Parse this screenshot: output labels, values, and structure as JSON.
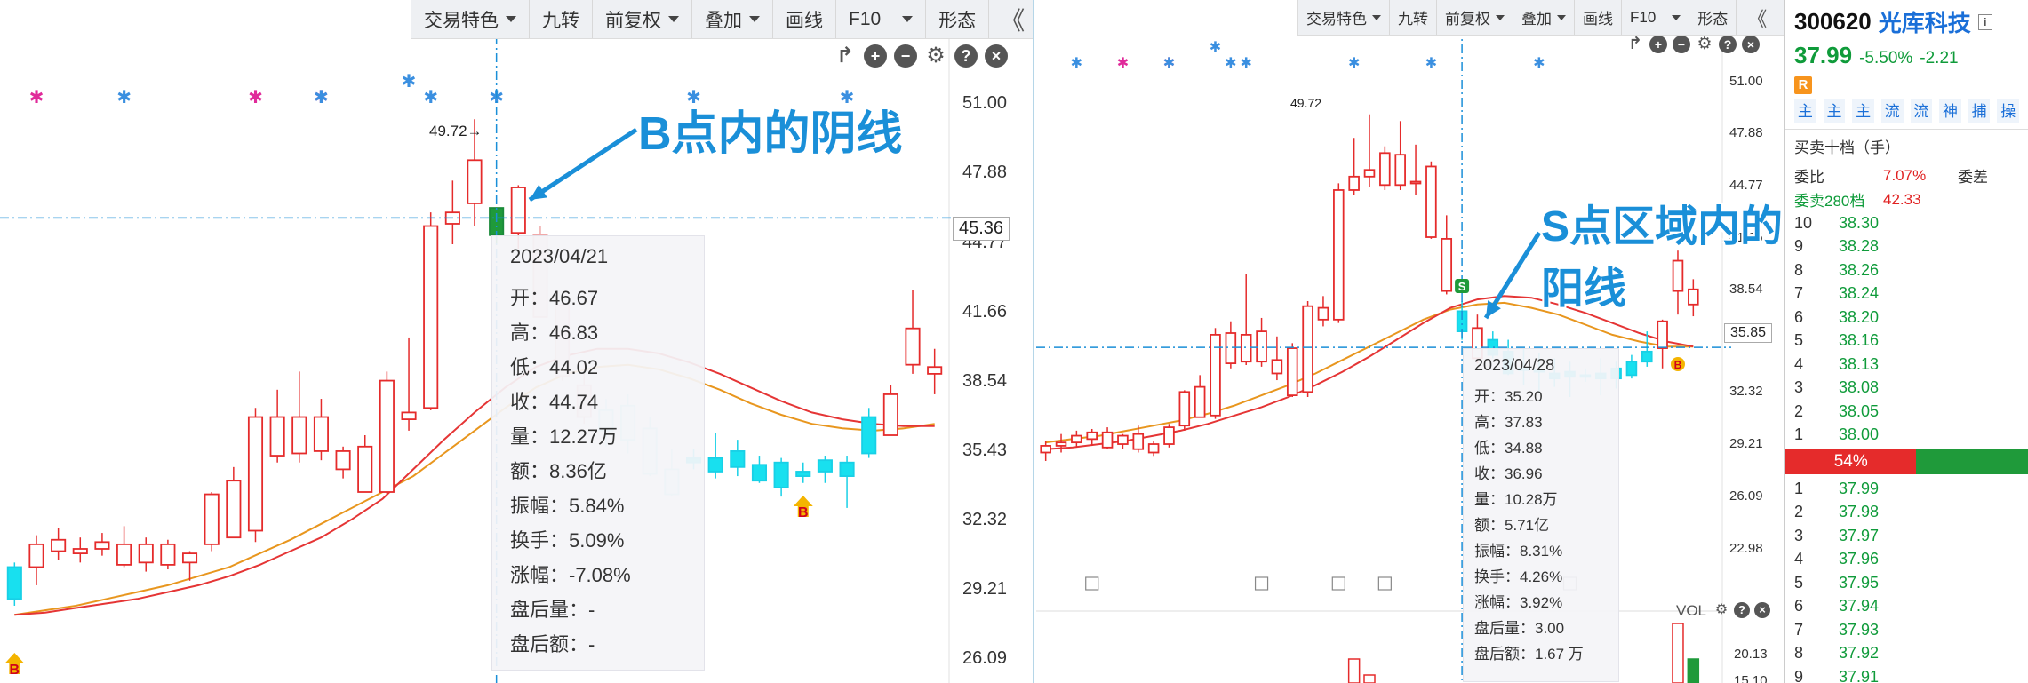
{
  "left_panel": {
    "toolbar": [
      "交易特色",
      "九转",
      "前复权",
      "叠加",
      "画线",
      "F10",
      "形态"
    ],
    "toolbar_dropdown": [
      true,
      false,
      true,
      true,
      false,
      true,
      false
    ],
    "collapse": "《",
    "price_axis": [
      "51.00",
      "47.88",
      "44.77",
      "41.66",
      "38.54",
      "35.43",
      "32.32",
      "29.21",
      "26.09"
    ],
    "price_range": [
      24.9,
      52.6
    ],
    "crosshair_price": "45.36",
    "peak_label": "49.72→",
    "annotation": "B点内的阴线",
    "tooltip": {
      "date": "2023/04/21",
      "rows": [
        "开：46.67",
        "高：46.83",
        "低：44.02",
        "收：44.74",
        "量：12.27万",
        "额：8.36亿",
        "振幅：5.84%",
        "换手：5.09%",
        "涨幅：-7.08%",
        "盘后量：-",
        "盘后额：-"
      ]
    },
    "candles": [
      [
        28.6,
        30.2,
        28.3,
        30.0
      ],
      [
        30.0,
        31.4,
        29.2,
        31.0
      ],
      [
        31.2,
        31.7,
        30.3,
        30.7
      ],
      [
        30.6,
        31.3,
        30.2,
        30.8
      ],
      [
        30.8,
        31.5,
        30.5,
        31.1
      ],
      [
        31.0,
        31.8,
        30.0,
        30.1
      ],
      [
        30.2,
        31.3,
        29.8,
        31.0
      ],
      [
        31.0,
        31.2,
        29.9,
        30.1
      ],
      [
        30.2,
        30.7,
        29.4,
        30.6
      ],
      [
        31.0,
        33.3,
        30.7,
        33.2
      ],
      [
        33.8,
        34.4,
        31.3,
        31.3
      ],
      [
        31.6,
        37.0,
        31.1,
        36.6
      ],
      [
        36.6,
        37.8,
        34.6,
        34.9
      ],
      [
        35.0,
        38.6,
        34.6,
        36.6
      ],
      [
        36.6,
        37.4,
        34.7,
        35.1
      ],
      [
        35.1,
        35.3,
        33.9,
        34.3
      ],
      [
        35.3,
        35.8,
        33.3,
        33.3
      ],
      [
        33.3,
        38.6,
        33.2,
        38.2
      ],
      [
        36.5,
        40.1,
        36.0,
        36.8
      ],
      [
        37.0,
        45.6,
        36.9,
        45.0
      ],
      [
        45.1,
        47.0,
        44.2,
        45.6
      ],
      [
        46.0,
        49.7,
        45.0,
        47.9
      ],
      [
        44.6,
        45.5,
        44.2,
        45.8
      ],
      [
        46.7,
        46.8,
        44.0,
        44.7
      ],
      [
        44.6,
        45.0,
        41.0,
        41.0
      ],
      [
        41.5,
        41.8,
        38.2,
        38.4
      ],
      [
        38.0,
        39.0,
        36.3,
        36.6
      ],
      [
        36.0,
        37.4,
        35.3,
        36.9
      ],
      [
        37.1,
        37.6,
        35.0,
        35.6
      ],
      [
        36.1,
        36.6,
        34.0,
        34.1
      ],
      [
        34.3,
        35.2,
        33.1,
        33.2
      ],
      [
        34.8,
        35.2,
        34.3,
        34.6
      ],
      [
        34.8,
        35.9,
        33.9,
        34.2
      ],
      [
        35.1,
        35.6,
        34.0,
        34.4
      ],
      [
        34.5,
        34.9,
        33.7,
        33.8
      ],
      [
        33.5,
        34.8,
        33.1,
        34.6
      ],
      [
        34.0,
        34.6,
        33.7,
        34.2
      ],
      [
        34.7,
        34.9,
        33.7,
        34.2
      ],
      [
        34.6,
        34.9,
        32.6,
        34.0
      ],
      [
        35.0,
        37.0,
        34.8,
        36.6
      ],
      [
        37.6,
        38.0,
        35.8,
        35.8
      ],
      [
        40.5,
        42.2,
        38.5,
        38.9
      ],
      [
        38.8,
        39.6,
        37.6,
        38.5
      ]
    ],
    "candle_colors": [
      "c",
      "r",
      "r",
      "r",
      "r",
      "r",
      "r",
      "r",
      "r",
      "r",
      "r",
      "r",
      "r",
      "r",
      "r",
      "r",
      "r",
      "r",
      "r",
      "r",
      "r",
      "r",
      "g",
      "r",
      "rl",
      "rl",
      "rl",
      "cl",
      "cl",
      "cl",
      "cl",
      "c",
      "c",
      "c",
      "c",
      "c",
      "c",
      "c",
      "c",
      "c",
      "r",
      "r",
      "r"
    ],
    "ma_orange": [
      27.9,
      28.1,
      28.3,
      28.6,
      28.9,
      29.2,
      29.6,
      30.0,
      30.6,
      31.2,
      31.9,
      32.6,
      33.3,
      34.0,
      35.0,
      36.0,
      37.0,
      37.9,
      38.5,
      38.8,
      38.9,
      38.7,
      38.3,
      37.8,
      37.2,
      36.7,
      36.3,
      36.1,
      36.0,
      36.1,
      36.3
    ],
    "ma_red": [
      27.9,
      28.0,
      28.2,
      28.4,
      28.6,
      28.9,
      29.2,
      29.6,
      30.1,
      30.7,
      31.3,
      32.1,
      33.0,
      34.3,
      35.6,
      36.8,
      37.9,
      38.8,
      39.3,
      39.6,
      39.6,
      39.4,
      39.0,
      38.5,
      37.9,
      37.3,
      36.8,
      36.5,
      36.3,
      36.2,
      36.2
    ],
    "marks_pink": [
      1,
      11,
      14
    ],
    "marks_blue": [
      5,
      14,
      18,
      19,
      22,
      31,
      38
    ],
    "buy_marks": [
      "B",
      "B"
    ]
  },
  "right_panel": {
    "toolbar": [
      "交易特色",
      "九转",
      "前复权",
      "叠加",
      "画线",
      "F10",
      "形态"
    ],
    "toolbar_dropdown": [
      true,
      false,
      true,
      true,
      false,
      true,
      false
    ],
    "collapse": "《",
    "price_axis": [
      "51.00",
      "47.88",
      "44.77",
      "41.66",
      "38.54",
      "35.43",
      "32.32",
      "29.21",
      "26.09",
      "22.98"
    ],
    "price_range": [
      20.6,
      52.8
    ],
    "crosshair_price": "35.85",
    "peak_label": "49.72",
    "annotation": "S点区域内的阳线",
    "sell_mark": "S",
    "buy_mark": "B",
    "vol_label": "VOL",
    "vol_axis": [
      "20.13",
      "15.10"
    ],
    "tooltip": {
      "date": "2023/04/28",
      "rows": [
        "开：35.20",
        "高：37.83",
        "低：34.88",
        "收：36.96",
        "量：10.28万",
        "额：5.71亿",
        "振幅：8.31%",
        "换手：4.26%",
        "涨幅：3.92%",
        "盘后量：3.00",
        "盘后额：1.67 万"
      ]
    },
    "candles": [
      [
        29.6,
        30.3,
        29.1,
        30.0
      ],
      [
        30.0,
        30.7,
        29.6,
        30.2
      ],
      [
        30.2,
        30.9,
        29.9,
        30.6
      ],
      [
        30.4,
        31.0,
        30.0,
        30.8
      ],
      [
        30.8,
        31.1,
        29.8,
        29.9
      ],
      [
        30.1,
        30.7,
        29.8,
        30.6
      ],
      [
        30.7,
        31.2,
        29.6,
        29.8
      ],
      [
        29.6,
        30.3,
        29.4,
        30.1
      ],
      [
        30.1,
        31.3,
        29.9,
        31.1
      ],
      [
        31.2,
        33.3,
        30.9,
        33.2
      ],
      [
        33.5,
        34.2,
        31.7,
        31.7
      ],
      [
        31.8,
        37.0,
        31.6,
        36.6
      ],
      [
        36.7,
        37.4,
        34.6,
        34.9
      ],
      [
        35.0,
        40.2,
        34.8,
        36.6
      ],
      [
        36.8,
        37.6,
        34.7,
        35.0
      ],
      [
        35.1,
        36.5,
        33.9,
        34.3
      ],
      [
        35.8,
        36.1,
        32.9,
        33.0
      ],
      [
        33.2,
        38.6,
        32.9,
        38.3
      ],
      [
        38.2,
        38.9,
        37.1,
        37.5
      ],
      [
        37.5,
        45.6,
        37.3,
        45.2
      ],
      [
        45.2,
        48.3,
        44.9,
        46.0
      ],
      [
        46.0,
        49.7,
        45.4,
        46.4
      ],
      [
        45.5,
        47.8,
        45.2,
        47.4
      ],
      [
        47.3,
        49.3,
        45.2,
        45.5
      ],
      [
        45.6,
        47.9,
        44.9,
        45.7
      ],
      [
        46.6,
        46.9,
        42.3,
        42.4
      ],
      [
        42.3,
        43.7,
        39.0,
        39.2
      ],
      [
        38.0,
        38.6,
        36.3,
        36.8
      ],
      [
        35.2,
        37.8,
        34.9,
        37.0
      ],
      [
        36.3,
        36.8,
        35.2,
        35.4
      ],
      [
        35.6,
        36.3,
        34.2,
        34.3
      ],
      [
        34.6,
        35.8,
        33.6,
        34.5
      ],
      [
        34.5,
        35.5,
        33.2,
        34.4
      ],
      [
        34.3,
        35.2,
        33.5,
        34.0
      ],
      [
        34.4,
        35.0,
        32.9,
        34.1
      ],
      [
        34.2,
        34.6,
        33.8,
        34.2
      ],
      [
        34.0,
        35.2,
        33.0,
        34.3
      ],
      [
        34.6,
        35.0,
        33.4,
        34.0
      ],
      [
        34.2,
        35.4,
        34.0,
        35.0
      ],
      [
        35.0,
        36.8,
        34.7,
        35.6
      ],
      [
        35.8,
        37.5,
        34.6,
        37.4
      ],
      [
        39.2,
        41.6,
        37.8,
        41.0
      ],
      [
        39.3,
        39.9,
        37.7,
        38.4
      ]
    ],
    "candle_colors": [
      "r",
      "r",
      "r",
      "r",
      "r",
      "r",
      "r",
      "r",
      "r",
      "r",
      "r",
      "r",
      "r",
      "r",
      "r",
      "r",
      "r",
      "r",
      "r",
      "r",
      "r",
      "r",
      "r",
      "r",
      "r",
      "r",
      "r",
      "c",
      "r",
      "c",
      "c",
      "c",
      "c",
      "c",
      "c",
      "c",
      "c",
      "c",
      "c",
      "c",
      "r",
      "r",
      "r"
    ],
    "ma_orange": [
      30.2,
      30.4,
      30.6,
      30.9,
      31.2,
      31.5,
      31.9,
      32.4,
      33.0,
      33.6,
      34.3,
      35.1,
      35.9,
      36.7,
      37.5,
      38.1,
      38.4,
      38.5,
      38.2,
      37.8,
      37.2,
      36.6,
      36.2,
      35.9,
      35.9
    ],
    "ma_red": [
      29.8,
      29.9,
      30.1,
      30.3,
      30.6,
      30.9,
      31.3,
      31.8,
      32.3,
      32.9,
      33.6,
      34.4,
      35.3,
      36.3,
      37.3,
      38.2,
      38.7,
      38.9,
      38.8,
      38.4,
      37.9,
      37.3,
      36.7,
      36.2,
      35.9
    ],
    "marks_pink": [
      5,
      8
    ],
    "marks_blue": [
      2,
      8,
      11,
      12,
      13,
      20,
      25,
      32
    ],
    "bottom_icons": [
      "calendar-icon",
      "calendar-icon",
      "calendar-icon",
      "calendar-icon",
      "calendar-icon"
    ]
  },
  "quote_panel": {
    "code": "300620",
    "name": "光库科技",
    "info": "i",
    "price": "37.99",
    "change_pct": "-5.50%",
    "change": "-2.21",
    "badge": "R",
    "tabs": [
      "主",
      "主",
      "主",
      "流",
      "流",
      "神",
      "捕",
      "操"
    ],
    "book_title": "买卖十档（手）",
    "weibi_label": "委比",
    "weibi_value": "7.07%",
    "weicha_label": "委差",
    "wei_label": "委卖280档",
    "wei_value": "42.33",
    "sell_rows": [
      [
        "10",
        "38.30"
      ],
      [
        "9",
        "38.28"
      ],
      [
        "8",
        "38.26"
      ],
      [
        "7",
        "38.24"
      ],
      [
        "6",
        "38.20"
      ],
      [
        "5",
        "38.16"
      ],
      [
        "4",
        "38.13"
      ],
      [
        "3",
        "38.08"
      ],
      [
        "2",
        "38.05"
      ],
      [
        "1",
        "38.00"
      ]
    ],
    "ratio_label": "54%",
    "ratio": 0.54,
    "buy_rows": [
      [
        "1",
        "37.99"
      ],
      [
        "2",
        "37.98"
      ],
      [
        "3",
        "37.97"
      ],
      [
        "4",
        "37.96"
      ],
      [
        "5",
        "37.95"
      ],
      [
        "6",
        "37.94"
      ],
      [
        "7",
        "37.93"
      ],
      [
        "8",
        "37.92"
      ],
      [
        "9",
        "37.91"
      ]
    ],
    "colors": {
      "up": "#e52b2b",
      "down": "#0f9b3a",
      "accent": "#1a6fd8",
      "flat_up": "#f6dede",
      "flat_cyan": "#d9f3f8"
    }
  }
}
